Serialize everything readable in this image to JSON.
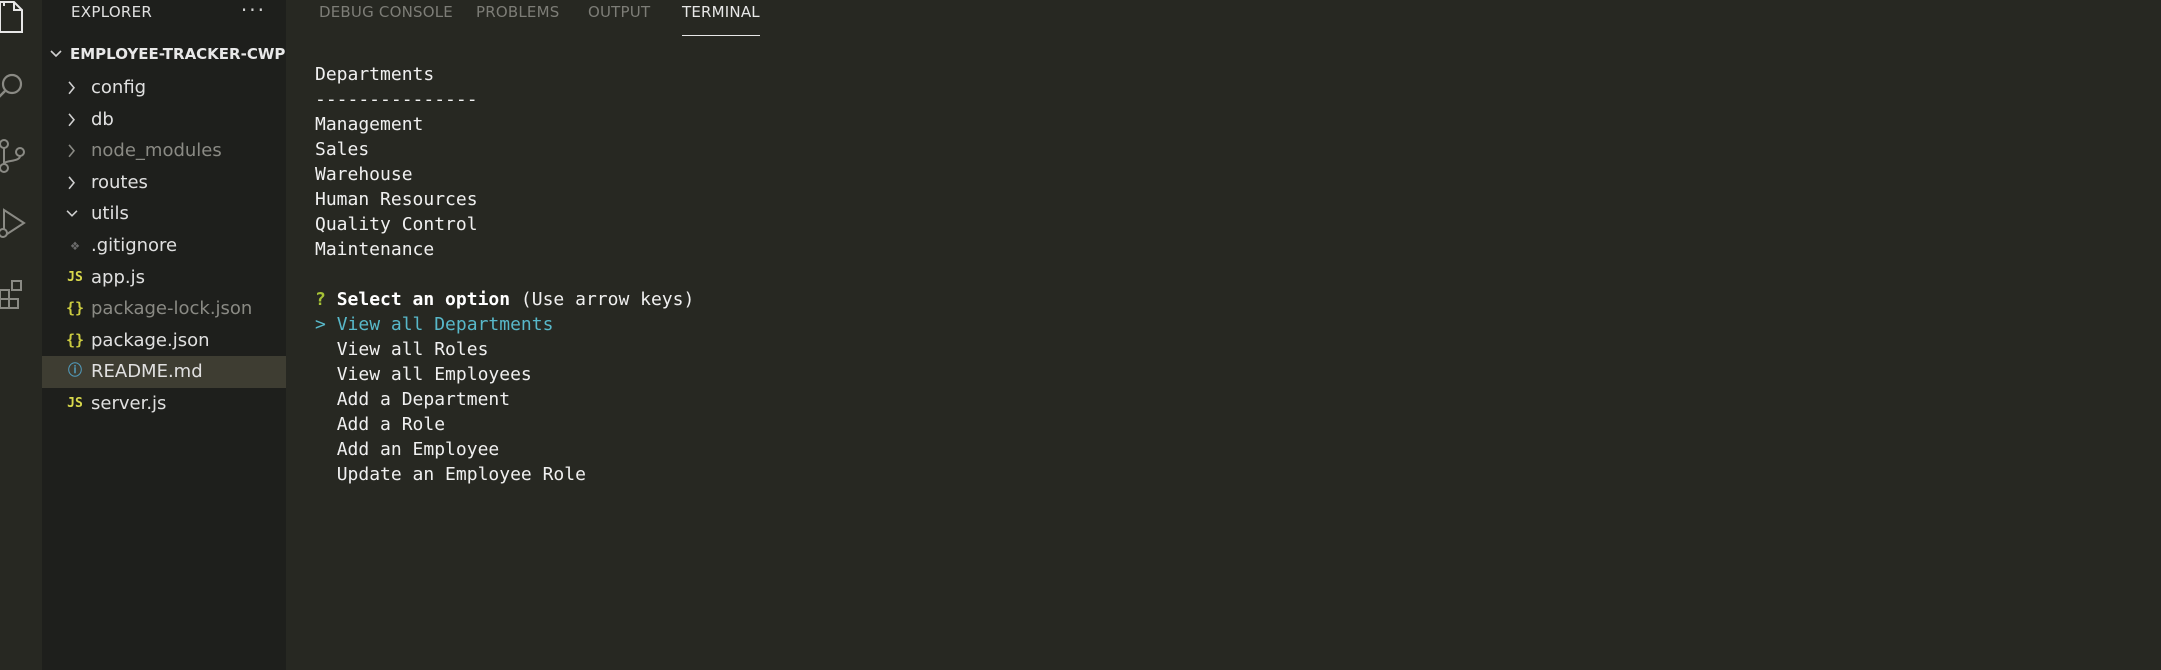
{
  "sidebar": {
    "header": "EXPLORER",
    "more": "···",
    "root": "EMPLOYEE-TRACKER-CWP",
    "items": [
      {
        "label": "config",
        "type": "folder"
      },
      {
        "label": "db",
        "type": "folder"
      },
      {
        "label": "node_modules",
        "type": "folder"
      },
      {
        "label": "routes",
        "type": "folder"
      },
      {
        "label": "utils",
        "type": "folder-open"
      },
      {
        "label": ".gitignore",
        "icon": "❖"
      },
      {
        "label": "app.js",
        "icon": "JS"
      },
      {
        "label": "package-lock.json",
        "icon": "{}"
      },
      {
        "label": "package.json",
        "icon": "{}"
      },
      {
        "label": "README.md",
        "icon": "ⓘ"
      },
      {
        "label": "server.js",
        "icon": "JS"
      }
    ]
  },
  "panel": {
    "tabs": [
      "DEBUG CONSOLE",
      "PROBLEMS",
      "OUTPUT",
      "TERMINAL"
    ]
  },
  "terminal": {
    "title": "Departments",
    "separator": "---------------",
    "departments": [
      "Management",
      "Sales",
      "Warehouse",
      "Human Resources",
      "Quality Control",
      "Maintenance"
    ],
    "prompt_mark": "?",
    "prompt": "Select an option",
    "prompt_hint": "(Use arrow keys)",
    "cursor": ">",
    "options": [
      "View all Departments",
      "View all Roles",
      "View all Employees",
      "Add a Department",
      "Add a Role",
      "Add an Employee",
      "Update an Employee Role"
    ]
  }
}
